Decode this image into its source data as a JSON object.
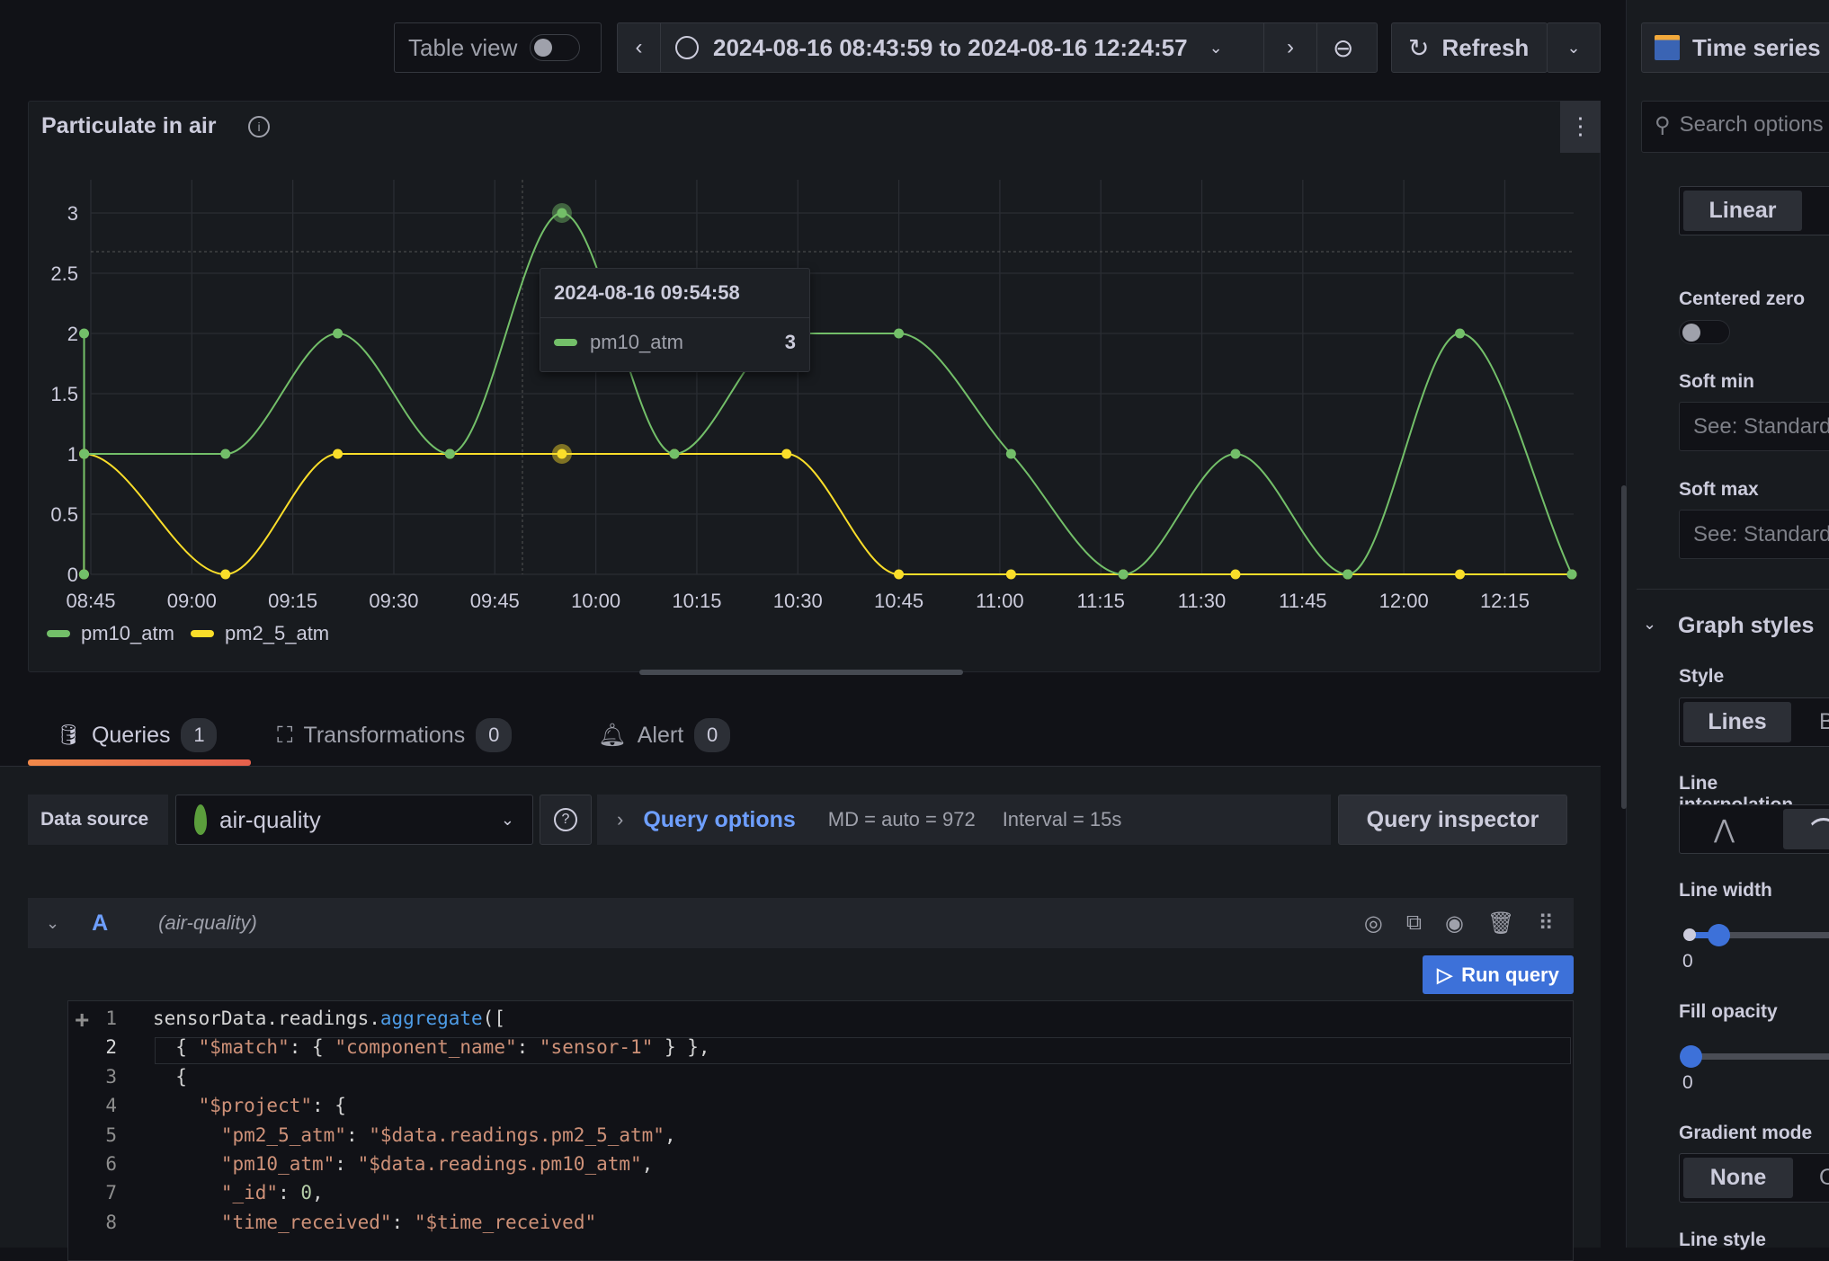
{
  "toolbar": {
    "table_view": "Table view",
    "time_range": "2024-08-16 08:43:59 to 2024-08-16 12:24:57",
    "refresh": "Refresh",
    "visualization": "Time series"
  },
  "panel": {
    "title": "Particulate in air",
    "tooltip": {
      "time": "2024-08-16 09:54:58",
      "series": "pm10_atm",
      "value": "3"
    }
  },
  "chart_data": {
    "type": "line",
    "x": [
      "08:43:59",
      "08:44:00",
      "08:44:01",
      "09:05:00",
      "09:21:40",
      "09:38:20",
      "09:54:58",
      "10:11:40",
      "10:28:20",
      "10:45:00",
      "11:01:40",
      "11:18:20",
      "11:35:00",
      "11:51:40",
      "12:08:20",
      "12:24:57"
    ],
    "series": [
      {
        "name": "pm10_atm",
        "color": "#73bf69",
        "values": [
          0,
          2,
          1,
          1,
          2,
          1,
          3,
          1,
          2,
          2,
          1,
          0,
          1,
          0,
          2,
          0
        ]
      },
      {
        "name": "pm2_5_atm",
        "color": "#fade2a",
        "values": [
          0,
          1,
          1,
          0,
          1,
          1,
          1,
          1,
          1,
          0,
          0,
          0,
          0,
          0,
          0,
          0
        ]
      }
    ],
    "y_ticks": [
      "0",
      "0.5",
      "1",
      "1.5",
      "2",
      "2.5",
      "3"
    ],
    "x_ticks": [
      "08:45",
      "09:00",
      "09:15",
      "09:30",
      "09:45",
      "10:00",
      "10:15",
      "10:30",
      "10:45",
      "11:00",
      "11:15",
      "11:30",
      "11:45",
      "12:00",
      "12:15"
    ],
    "ylim": [
      0,
      3.2
    ],
    "grid": true,
    "legend": "bottom-left",
    "interpolation": "smooth"
  },
  "tabs": [
    {
      "label": "Queries",
      "count": "1"
    },
    {
      "label": "Transformations",
      "count": "0"
    },
    {
      "label": "Alert",
      "count": "0"
    }
  ],
  "query": {
    "ds_label": "Data source",
    "ds_value": "air-quality",
    "options_label": "Query options",
    "md": "MD = auto = 972",
    "interval": "Interval = 15s",
    "inspector": "Query inspector",
    "ref": "A",
    "ref_ds": "(air-quality)",
    "run": "Run query"
  },
  "code": [
    [
      [
        "sensorData.readings.",
        "p"
      ],
      [
        "aggregate",
        "f"
      ],
      [
        "([",
        "p"
      ]
    ],
    [
      [
        "  { ",
        "p"
      ],
      [
        "\"$match\"",
        "s"
      ],
      [
        ": { ",
        "p"
      ],
      [
        "\"component_name\"",
        "s"
      ],
      [
        ": ",
        "p"
      ],
      [
        "\"sensor-1\"",
        "s"
      ],
      [
        " } },",
        "p"
      ]
    ],
    [
      [
        "  {",
        "p"
      ]
    ],
    [
      [
        "    ",
        "p"
      ],
      [
        "\"$project\"",
        "s"
      ],
      [
        ": {",
        "p"
      ]
    ],
    [
      [
        "      ",
        "p"
      ],
      [
        "\"pm2_5_atm\"",
        "s"
      ],
      [
        ": ",
        "p"
      ],
      [
        "\"$data.readings.pm2_5_atm\"",
        "s"
      ],
      [
        ",",
        "p"
      ]
    ],
    [
      [
        "      ",
        "p"
      ],
      [
        "\"pm10_atm\"",
        "s"
      ],
      [
        ": ",
        "p"
      ],
      [
        "\"$data.readings.pm10_atm\"",
        "s"
      ],
      [
        ",",
        "p"
      ]
    ],
    [
      [
        "      ",
        "p"
      ],
      [
        "\"_id\"",
        "s"
      ],
      [
        ": ",
        "p"
      ],
      [
        "0",
        "n"
      ],
      [
        ",",
        "p"
      ]
    ],
    [
      [
        "      ",
        "p"
      ],
      [
        "\"time_received\"",
        "s"
      ],
      [
        ": ",
        "p"
      ],
      [
        "\"$time_received\"",
        "s"
      ]
    ]
  ],
  "options": {
    "search_placeholder": "Search options",
    "scale": "Linear",
    "centered_zero": "Centered zero",
    "soft_min": "Soft min",
    "soft_min_ph": "See: Standard options",
    "soft_max": "Soft max",
    "soft_max_ph": "See: Standard options",
    "graph_styles": "Graph styles",
    "style": "Style",
    "style_value": "Lines",
    "style_next": "B",
    "line_interp": "Line interpolation",
    "line_width": "Line width",
    "line_width_value": "1",
    "line_width_min": "0",
    "fill_opacity": "Fill opacity",
    "fill_opacity_value": "0",
    "fill_opacity_min": "0",
    "gradient_mode": "Gradient mode",
    "gradient_value": "None",
    "gradient_next": "O",
    "line_style": "Line style"
  }
}
